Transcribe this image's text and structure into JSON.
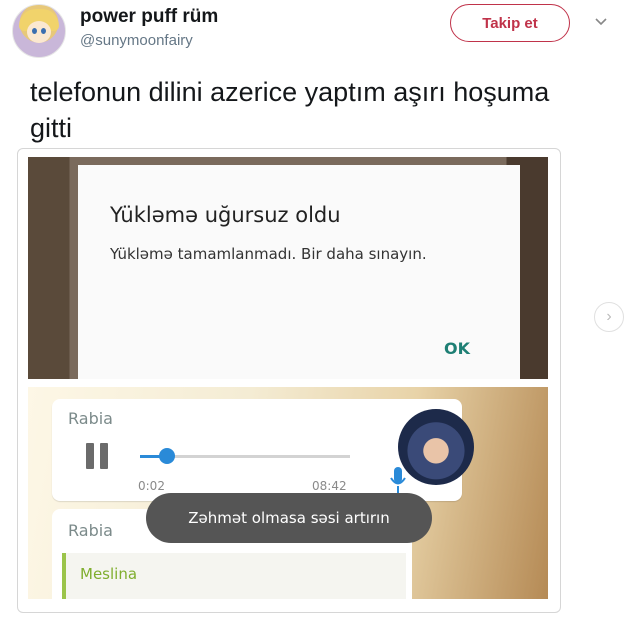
{
  "tweet": {
    "display_name": "power puff rüm",
    "handle": "@sunymoonfairy",
    "follow_label": "Takip et",
    "text": "telefonun dilini azerice yaptım aşırı hoşuma gitti"
  },
  "dialog": {
    "title": "Yükləmə uğursuz oldu",
    "message": "Yükləmə tamamlanmadı. Bir daha sınayın.",
    "ok_label": "OK"
  },
  "chat": {
    "sender1": "Rabia",
    "time_current": "0:02",
    "time_total": "08:42",
    "progress": 0.08,
    "sender2": "Rabia",
    "quoted_name": "Meslina",
    "toast": "Zəhmət olmasa səsi artırın"
  },
  "colors": {
    "follow_accent": "#c0334a",
    "dialog_ok": "#1e7f74",
    "player_accent": "#2a8ad8",
    "quote_accent": "#9bc44a"
  },
  "icons": [
    "chevron-down-icon",
    "pause-icon",
    "mic-icon",
    "chevron-right-icon"
  ]
}
